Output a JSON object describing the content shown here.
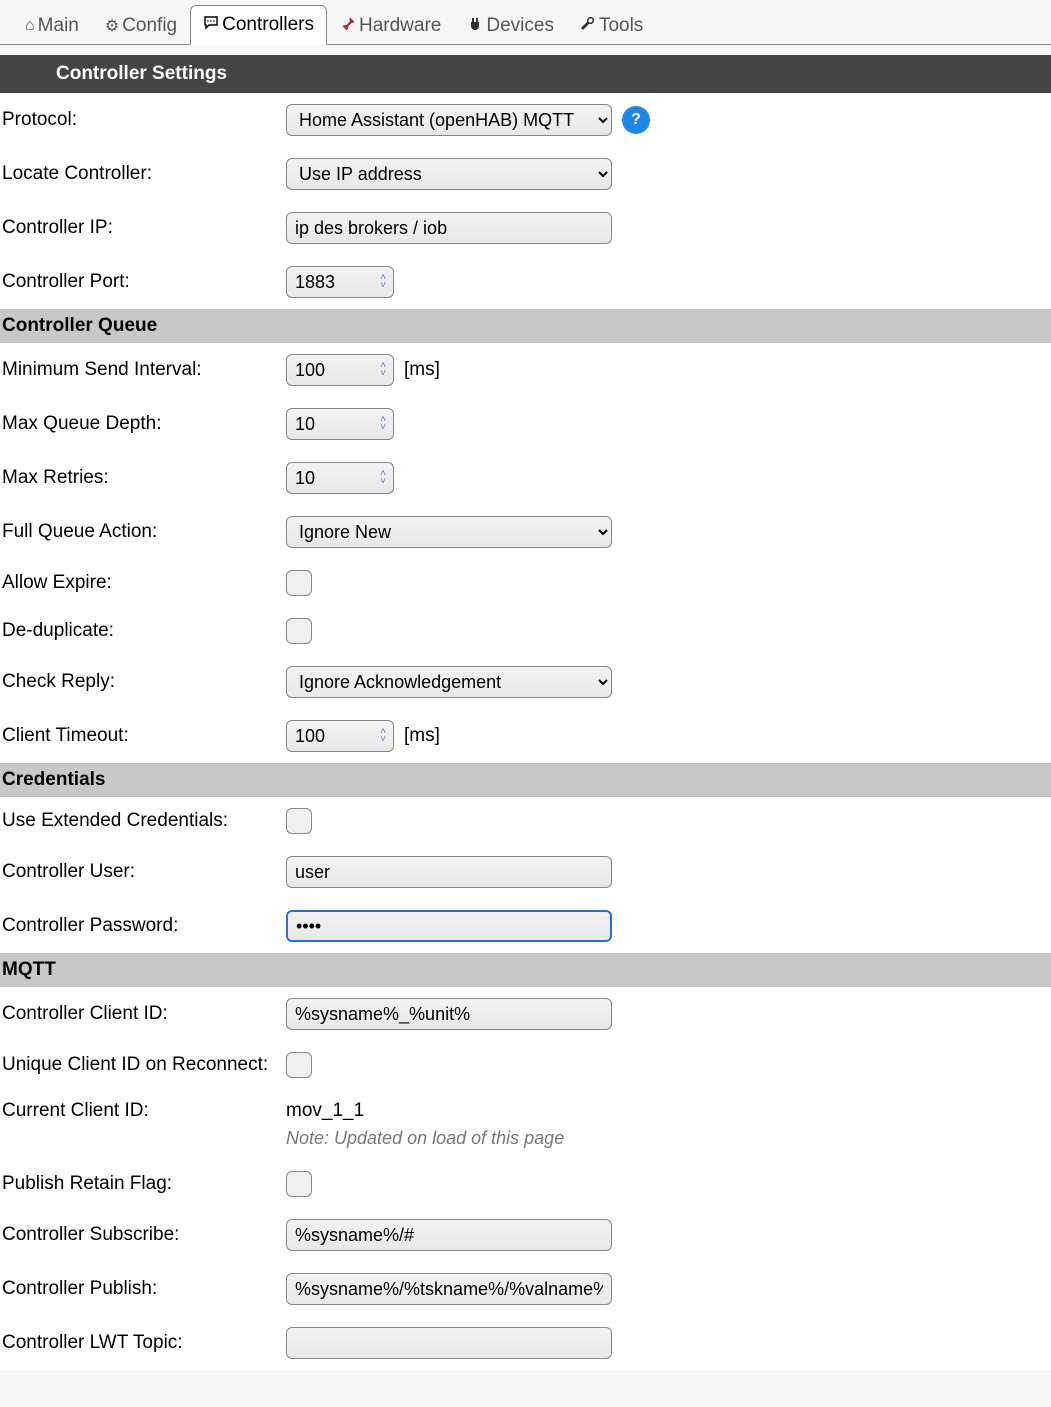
{
  "tabs": {
    "main": "Main",
    "config": "Config",
    "controllers": "Controllers",
    "hardware": "Hardware",
    "devices": "Devices",
    "tools": "Tools"
  },
  "header": "Controller Settings",
  "section_queue": "Controller Queue",
  "section_credentials": "Credentials",
  "section_mqtt": "MQTT",
  "labels": {
    "protocol": "Protocol:",
    "locate": "Locate Controller:",
    "ip": "Controller IP:",
    "port": "Controller Port:",
    "min_send": "Minimum Send Interval:",
    "max_queue": "Max Queue Depth:",
    "max_retries": "Max Retries:",
    "full_queue": "Full Queue Action:",
    "allow_expire": "Allow Expire:",
    "dedup": "De-duplicate:",
    "check_reply": "Check Reply:",
    "client_timeout": "Client Timeout:",
    "use_ext": "Use Extended Credentials:",
    "user": "Controller User:",
    "password": "Controller Password:",
    "client_id": "Controller Client ID:",
    "unique_id": "Unique Client ID on Reconnect:",
    "current_id": "Current Client ID:",
    "retain": "Publish Retain Flag:",
    "subscribe": "Controller Subscribe:",
    "publish": "Controller Publish:",
    "lwt": "Controller LWT Topic:"
  },
  "values": {
    "protocol": "Home Assistant (openHAB) MQTT",
    "locate": "Use IP address",
    "ip": "ip des brokers / iob",
    "port": "1883",
    "min_send": "100",
    "max_queue": "10",
    "max_retries": "10",
    "full_queue": "Ignore New",
    "check_reply": "Ignore Acknowledgement",
    "client_timeout": "100",
    "user": "user",
    "password": "••••",
    "client_id": "%sysname%_%unit%",
    "current_id": "mov_1_1",
    "subscribe": "%sysname%/#",
    "publish": "%sysname%/%tskname%/%valname%",
    "lwt": ""
  },
  "units": {
    "ms": "[ms]"
  },
  "notes": {
    "current_id": "Note: Updated on load of this page"
  },
  "help_glyph": "?"
}
